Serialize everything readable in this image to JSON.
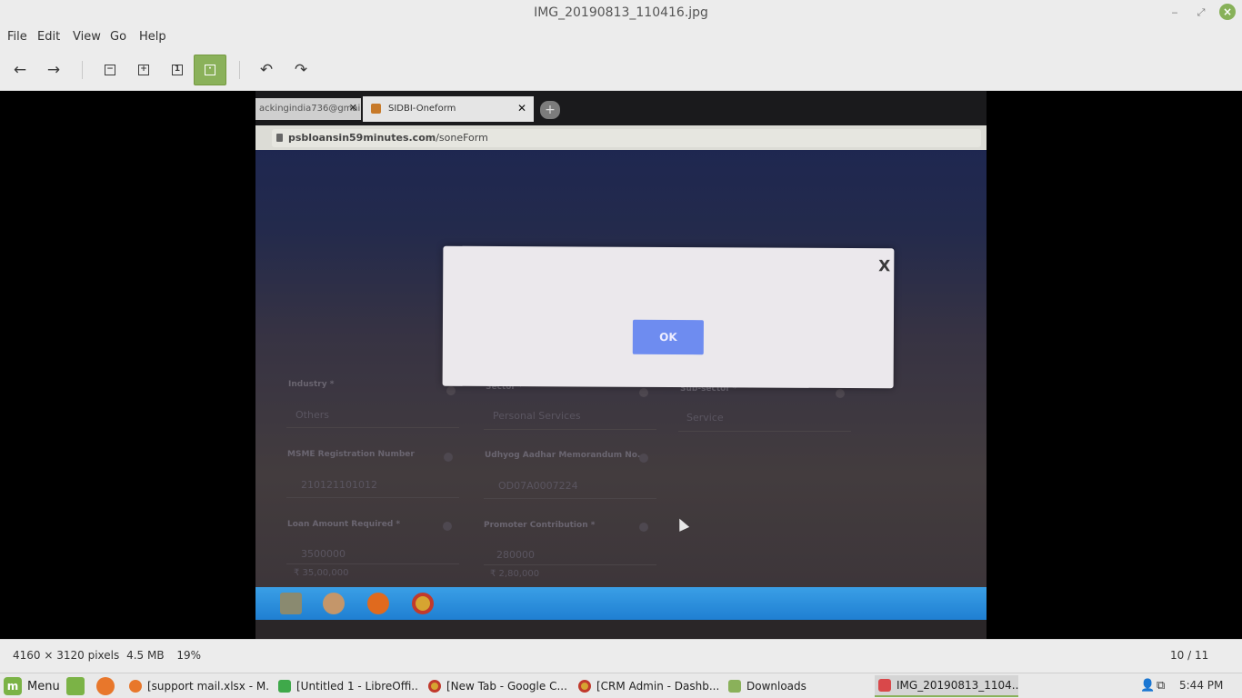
{
  "window": {
    "title": "IMG_20190813_110416.jpg",
    "minimize": "‒",
    "maximize": "⤢",
    "close": "×"
  },
  "menubar": [
    "File",
    "Edit",
    "View",
    "Go",
    "Help"
  ],
  "toolbar": {
    "back": "←",
    "forward": "→",
    "zoom_out": "−",
    "zoom_in": "+",
    "normal_size": "1",
    "best_fit": "▣",
    "rotate_left": "↶",
    "rotate_right": "↷"
  },
  "photo": {
    "tab1_text": "ackingindia736@gmail.",
    "tab1_close": "✕",
    "tab2_text": "SIDBI-Oneform",
    "tab2_close": "✕",
    "newtab": "+",
    "url_bold": "psbloansin59minutes.com",
    "url_rest": "/soneForm",
    "dialog_close": "X",
    "dialog_ok": "OK",
    "fields": {
      "industry_label": "Industry *",
      "industry_value": "Others",
      "sector_label": "Sector *",
      "sector_value": "Personal Services",
      "subsector_label": "Sub-sector *",
      "subsector_value": "Service",
      "msme_label": "MSME Registration Number",
      "msme_value": "210121101012",
      "udhyog_label": "Udhyog Aadhar Memorandum No.",
      "udhyog_value": "OD07A0007224",
      "loan_label": "Loan Amount Required *",
      "loan_value": "3500000",
      "loan_formatted": "₹ 35,00,000",
      "promoter_label": "Promoter Contribution *",
      "promoter_value": "280000",
      "promoter_formatted": "₹ 2,80,000"
    }
  },
  "statusbar": {
    "dimensions": "4160 × 3120 pixels",
    "size": "4.5 MB",
    "zoom": "19%",
    "position": "10 / 11"
  },
  "taskbar": {
    "menu_label": "Menu",
    "mint_glyph": "m",
    "tasks": [
      "[support mail.xlsx - M...",
      "[Untitled 1 - LibreOffi...",
      "[New Tab - Google C...",
      "[CRM Admin - Dashb...",
      "Downloads",
      "IMG_20190813_1104..."
    ],
    "time": "5:44 PM"
  },
  "colors": {
    "accent": "#8ab15a",
    "dialog_ok": "#6e8cf0"
  }
}
